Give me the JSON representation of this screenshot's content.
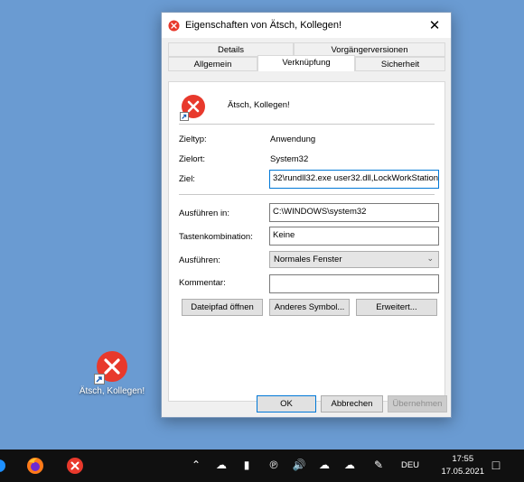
{
  "desktop": {
    "shortcut_label": "Ätsch, Kollegen!"
  },
  "dialog": {
    "title": "Eigenschaften von Ätsch, Kollegen!",
    "close": "✕",
    "tabs_row1": [
      "Details",
      "Vorgängerversionen"
    ],
    "tabs_row2": [
      "Allgemein",
      "Verknüpfung",
      "Sicherheit"
    ],
    "active_tab": "Verknüpfung",
    "shortcut_name": "Ätsch, Kollegen!",
    "zieltyp_label": "Zieltyp:",
    "zieltyp_value": "Anwendung",
    "zielort_label": "Zielort:",
    "zielort_value": "System32",
    "ziel_label": "Ziel:",
    "ziel_value": "32\\rundll32.exe user32.dll,LockWorkStation",
    "ausfuehren_in_label": "Ausführen in:",
    "ausfuehren_in_value": "C:\\WINDOWS\\system32",
    "tastenkombination_label": "Tastenkombination:",
    "tastenkombination_value": "Keine",
    "ausfuehren_label": "Ausführen:",
    "ausfuehren_value": "Normales Fenster",
    "kommentar_label": "Kommentar:",
    "kommentar_value": "",
    "btn_dateipfad": "Dateipfad öffnen",
    "btn_symbol": "Anderes Symbol...",
    "btn_erweitert": "Erweitert...",
    "btn_ok": "OK",
    "btn_abbrechen": "Abbrechen",
    "btn_uebernehmen": "Übernehmen"
  },
  "taskbar": {
    "language": "DEU",
    "time": "17:55",
    "date": "17.05.2021"
  },
  "colors": {
    "desktop_bg": "#6a9bd2",
    "icon_red": "#e8392c",
    "accent": "#0078d7"
  }
}
